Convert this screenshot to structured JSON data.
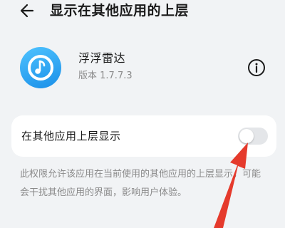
{
  "header": {
    "back_icon": "back-arrow-icon",
    "title": "显示在其他应用的上层"
  },
  "app": {
    "icon": "music-note-icon",
    "icon_color": "#2a9df4",
    "name": "浮浮雷达",
    "version": "版本 1.7.7.3",
    "info_icon": "info-icon"
  },
  "setting": {
    "label": "在其他应用上层显示",
    "toggle_on": false
  },
  "description": "此权限允许该应用在当前使用的其他应用的上层显示，可能会干扰其他应用的界面，影响用户体验。",
  "annotation": {
    "arrow_color": "#e53a2c"
  }
}
